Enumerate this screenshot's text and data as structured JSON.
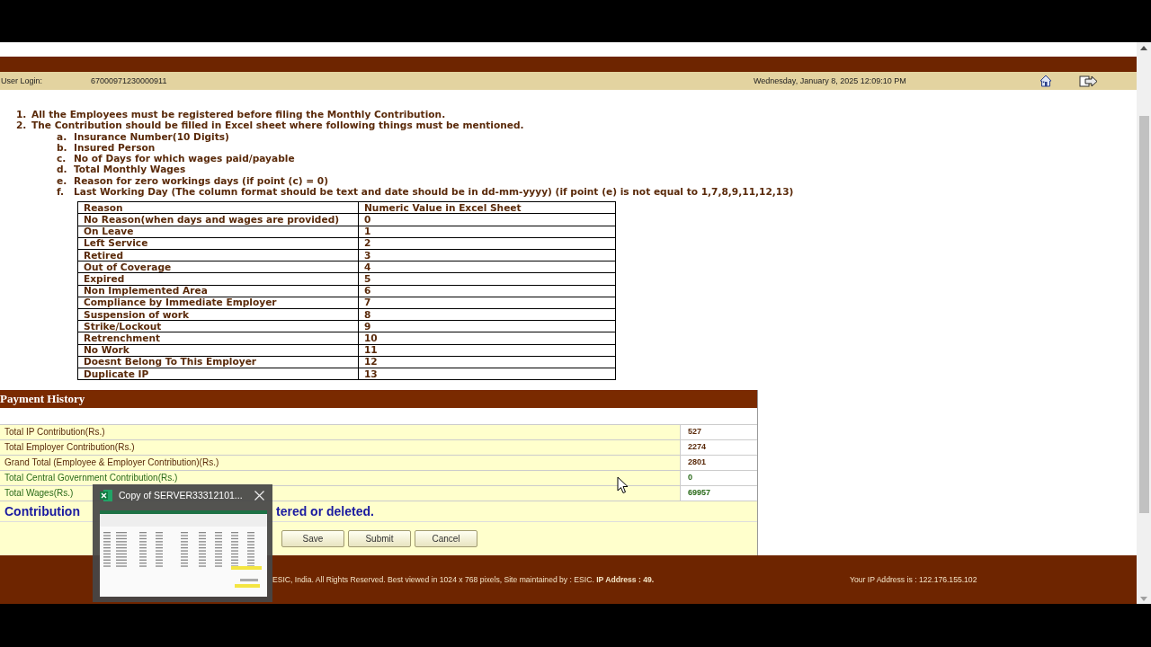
{
  "user_bar": {
    "label": "User Login:",
    "user_id": "67000971230000911",
    "datetime": "Wednesday, January 8, 2025 12:09:10 PM"
  },
  "instructions": [
    {
      "marker": "1.",
      "text": "All the Employees must be registered before filing the Monthly Contribution."
    },
    {
      "marker": "2.",
      "text": "The Contribution should be filled in Excel sheet where following things must be mentioned.",
      "children": [
        {
          "marker": "a.",
          "text": "Insurance Number(10 Digits)"
        },
        {
          "marker": "b.",
          "text": "Insured Person"
        },
        {
          "marker": "c.",
          "text": "No of Days for which wages paid/payable"
        },
        {
          "marker": "d.",
          "text": "Total Monthly Wages"
        },
        {
          "marker": "e.",
          "text": "Reason for zero workings days (if point (c) = 0)"
        },
        {
          "marker": "f.",
          "text": "Last Working Day (The column format should be text and date should be in dd-mm-yyyy) (if point (e) is not equal to 1,7,8,9,11,12,13)"
        }
      ]
    }
  ],
  "reason_table": {
    "columns": [
      "Reason",
      "Numeric Value in Excel Sheet"
    ],
    "rows": [
      [
        "No Reason(when days and wages are provided)",
        "0"
      ],
      [
        "On Leave",
        "1"
      ],
      [
        "Left Service",
        "2"
      ],
      [
        "Retired",
        "3"
      ],
      [
        "Out of Coverage",
        "4"
      ],
      [
        "Expired",
        "5"
      ],
      [
        "Non Implemented Area",
        "6"
      ],
      [
        "Compliance by Immediate Employer",
        "7"
      ],
      [
        "Suspension of work",
        "8"
      ],
      [
        "Strike/Lockout",
        "9"
      ],
      [
        "Retrenchment",
        "10"
      ],
      [
        "No Work",
        "11"
      ],
      [
        "Doesnt Belong To This Employer",
        "12"
      ],
      [
        "Duplicate IP",
        "13"
      ]
    ]
  },
  "payment_history": {
    "title": "Payment History",
    "rows": [
      {
        "label": "Total IP Contribution(Rs.)",
        "value": "527",
        "color": "#5a2a0a"
      },
      {
        "label": "Total Employer Contribution(Rs.)",
        "value": "2274",
        "color": "#5a2a0a"
      },
      {
        "label": "Grand Total (Employee & Employer Contribution)(Rs.)",
        "value": "2801",
        "color": "#5a2a0a"
      },
      {
        "label": "Total Central Government Contribution(Rs.)",
        "value": "0",
        "color": "#2a6a1a"
      },
      {
        "label": "Total Wages(Rs.)",
        "value": "69957",
        "color": "#2a6a1a"
      }
    ],
    "notice_start": "Contribution",
    "notice_end": "tered or deleted.",
    "buttons": [
      "Save",
      "Submit",
      "Cancel"
    ]
  },
  "footer": {
    "copyright": "ESIC, India. All Rights Reserved. Best viewed in 1024 x 768 pixels, Site maintained by : ESIC. **IP Address : 49.**",
    "ip": "Your IP Address is : 122.176.155.102"
  },
  "taskbar_preview": {
    "title": "Copy of SERVER33312101..."
  }
}
